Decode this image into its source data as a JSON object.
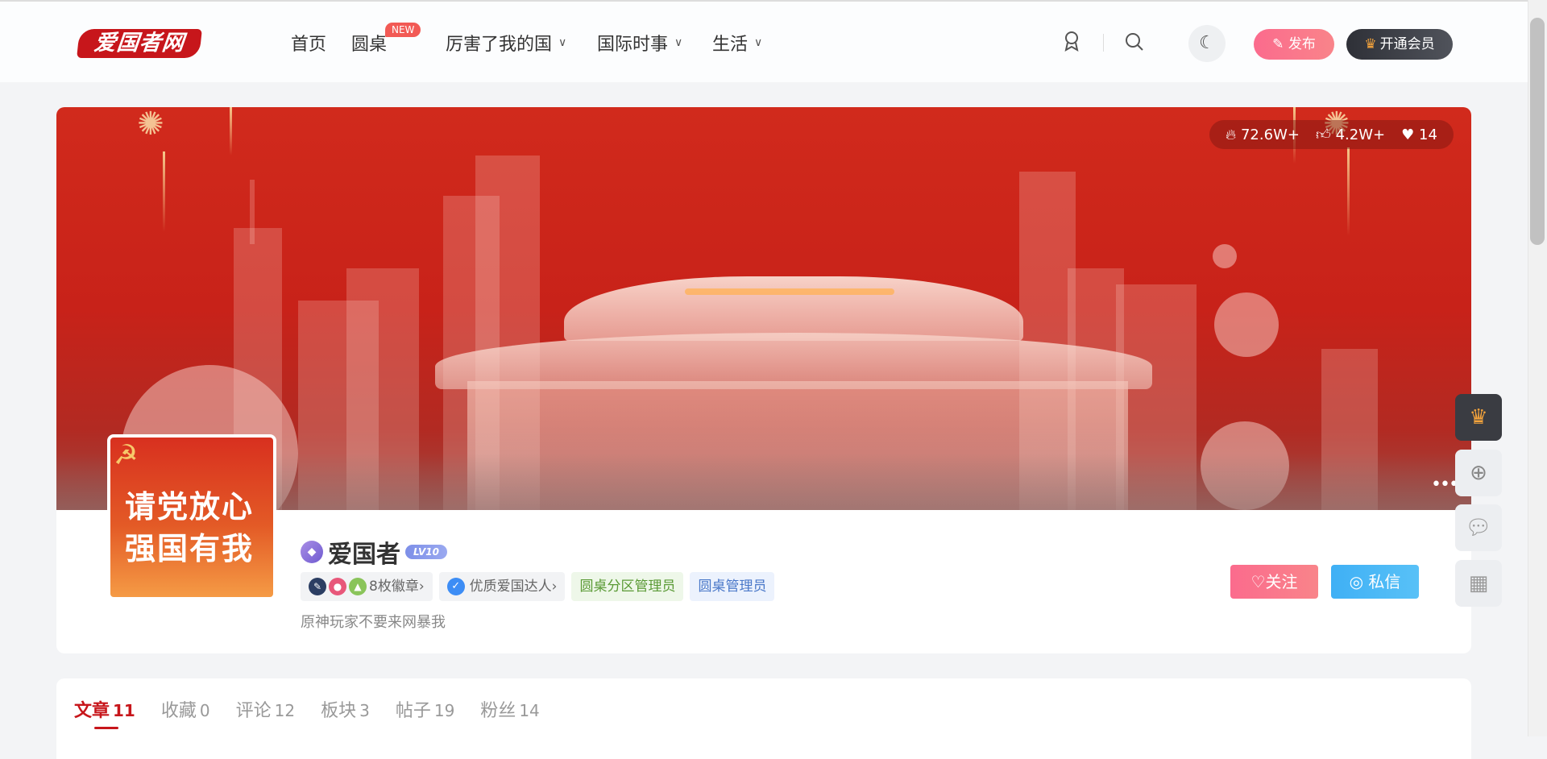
{
  "brand": {
    "logo_text": "爱国者网",
    "accent": "#c7161b"
  },
  "nav": {
    "home": "首页",
    "roundtable": "圆桌",
    "roundtable_badge": "NEW",
    "country": "厉害了我的国",
    "world": "国际时事",
    "life": "生活"
  },
  "header_actions": {
    "publish": "发布",
    "vip": "开通会员"
  },
  "profile": {
    "stats": {
      "views": "72.6W+",
      "likes": "4.2W+",
      "favorites": "14"
    },
    "avatar_text": "请党放心强国有我",
    "username": "爱国者",
    "level": "LV10",
    "badges_label": "8枚徽章",
    "expert_label": "优质爱国达人",
    "role_tags": [
      "圆桌分区管理员",
      "圆桌管理员"
    ],
    "bio": "原神玩家不要来网暴我",
    "follow": "关注",
    "message": "私信"
  },
  "tabs": [
    {
      "label": "文章",
      "count": "11"
    },
    {
      "label": "收藏",
      "count": "0"
    },
    {
      "label": "评论",
      "count": "12"
    },
    {
      "label": "板块",
      "count": "3"
    },
    {
      "label": "帖子",
      "count": "19"
    },
    {
      "label": "粉丝",
      "count": "14"
    }
  ],
  "icons": {
    "award": "award-icon",
    "search": "search-icon",
    "theme": "moon-icon",
    "crown": "crown-icon",
    "add": "add-circle-icon",
    "wechat": "wechat-icon",
    "qrcode": "qrcode-icon"
  }
}
